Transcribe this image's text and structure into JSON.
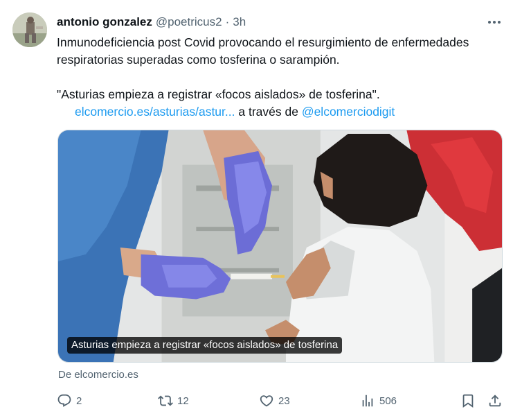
{
  "tweet": {
    "author_name": "antonio gonzalez",
    "handle": "@poetricus2",
    "separator": "·",
    "time": "3h",
    "text_line1": "Inmunodeficiencia post Covid provocando el resurgimiento de enfermedades",
    "text_line2": "respiratorias superadas como tosferina o sarampión.",
    "quote": "\"Asturias empieza a registrar «focos aislados» de tosferina\".",
    "link_url": "elcomercio.es/asturias/astur...",
    "via_text": "a través de",
    "via_handle": "@elcomerciodigit"
  },
  "card": {
    "caption": "Asturias empieza a registrar «focos aislados» de tosferina",
    "source": "De elcomercio.es"
  },
  "actions": {
    "replies": "2",
    "retweets": "12",
    "likes": "23",
    "views": "506"
  },
  "icons": {
    "more": "more-horizontal-icon",
    "reply": "reply-icon",
    "retweet": "retweet-icon",
    "like": "heart-icon",
    "views": "views-chart-icon",
    "bookmark": "bookmark-icon",
    "share": "share-icon"
  },
  "colors": {
    "text": "#0f1419",
    "secondary": "#536471",
    "link": "#1d9bf0",
    "border": "#cfd9de"
  }
}
